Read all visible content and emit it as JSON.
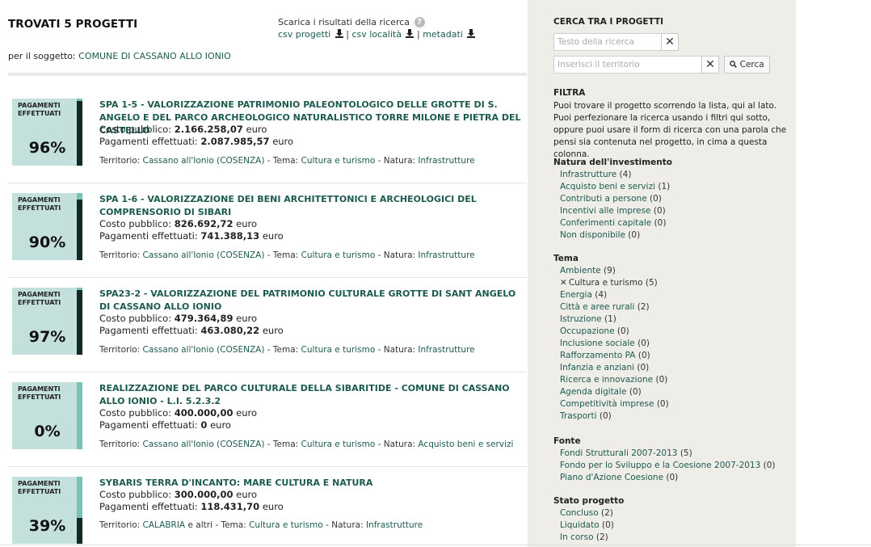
{
  "header": {
    "title": "TROVATI 5 PROGETTI",
    "subject_prefix": "per il soggetto:",
    "subject_value": "COMUNE DI CASSANO ALLO IONIO",
    "download_label": "Scarica i risultati della ricerca",
    "help_glyph": "?",
    "csv_progetti": "csv progetti",
    "csv_localita": "csv località",
    "metadati": "metadati",
    "sep": "|"
  },
  "projects": [
    {
      "badge_label_1": "PAGAMENTI",
      "badge_label_2": "EFFETTUATI",
      "percent": "96%",
      "progress": 0.96,
      "title": "SPA 1-5 - VALORIZZAZIONE PATRIMONIO PALEONTOLOGICO DELLE GROTTE DI S. ANGELO E DEL PARCO ARCHEOLOGICO NATURALISTICO TORRE MILONE E PIETRA DEL CASTELLO",
      "cost_label": "Costo pubblico:",
      "cost_value": "2.166.258,07",
      "paid_label": "Pagamenti effettuati:",
      "paid_value": "2.087.985,57",
      "unit": "euro",
      "territorio_label": "Territorio:",
      "territorio": "Cassano all'Ionio (COSENZA)",
      "tema_label": "- Tema:",
      "tema": "Cultura e turismo",
      "natura_label": "- Natura:",
      "natura": "Infrastrutture"
    },
    {
      "badge_label_1": "PAGAMENTI",
      "badge_label_2": "EFFETTUATI",
      "percent": "90%",
      "progress": 0.9,
      "title": "SPA 1-6 - VALORIZZAZIONE DEI BENI ARCHITETTONICI E ARCHEOLOGICI DEL COMPRENSORIO DI SIBARI",
      "cost_label": "Costo pubblico:",
      "cost_value": "826.692,72",
      "paid_label": "Pagamenti effettuati:",
      "paid_value": "741.388,13",
      "unit": "euro",
      "territorio_label": "Territorio:",
      "territorio": "Cassano all'Ionio (COSENZA)",
      "tema_label": "- Tema:",
      "tema": "Cultura e turismo",
      "natura_label": "- Natura:",
      "natura": "Infrastrutture"
    },
    {
      "badge_label_1": "PAGAMENTI",
      "badge_label_2": "EFFETTUATI",
      "percent": "97%",
      "progress": 0.97,
      "title": "SPA23-2 - VALORIZZAZIONE DEL PATRIMONIO CULTURALE GROTTE DI SANT ANGELO DI CASSANO ALLO IONIO",
      "cost_label": "Costo pubblico:",
      "cost_value": "479.364,89",
      "paid_label": "Pagamenti effettuati:",
      "paid_value": "463.080,22",
      "unit": "euro",
      "territorio_label": "Territorio:",
      "territorio": "Cassano all'Ionio (COSENZA)",
      "tema_label": "- Tema:",
      "tema": "Cultura e turismo",
      "natura_label": "- Natura:",
      "natura": "Infrastrutture"
    },
    {
      "badge_label_1": "PAGAMENTI",
      "badge_label_2": "EFFETTUATI",
      "percent": "0%",
      "progress": 0,
      "title": "REALIZZAZIONE DEL PARCO CULTURALE DELLA SIBARITIDE - COMUNE DI CASSANO ALLO IONIO - L.I. 5.2.3.2",
      "cost_label": "Costo pubblico:",
      "cost_value": "400.000,00",
      "paid_label": "Pagamenti effettuati:",
      "paid_value": "0",
      "unit": "euro",
      "territorio_label": "Territorio:",
      "territorio": "Cassano all'Ionio (COSENZA)",
      "tema_label": "- Tema:",
      "tema": "Cultura e turismo",
      "natura_label": "- Natura:",
      "natura": "Acquisto beni e servizi"
    },
    {
      "badge_label_1": "PAGAMENTI",
      "badge_label_2": "EFFETTUATI",
      "percent": "39%",
      "progress": 0.39,
      "title": "SYBARIS TERRA D'INCANTO: MARE CULTURA E NATURA",
      "cost_label": "Costo pubblico:",
      "cost_value": "300.000,00",
      "paid_label": "Pagamenti effettuati:",
      "paid_value": "118.431,70",
      "unit": "euro",
      "territorio_label": "Territorio:",
      "territorio": "CALABRIA",
      "territorio_extra": "e altri",
      "tema_label": "- Tema:",
      "tema": "Cultura e turismo",
      "natura_label": "- Natura:",
      "natura": "Infrastrutture"
    }
  ],
  "sidebar": {
    "search_title": "CERCA TRA I PROGETTI",
    "text_placeholder": "Testo della ricerca",
    "territory_placeholder": "Inserisci il territorio",
    "clear_glyph": "✕",
    "search_button": "Cerca",
    "filter_title": "FILTRA",
    "intro": "Puoi trovare il progetto scorrendo la lista, qui al lato. Puoi perfezionare la ricerca usando i filtri qui sotto, oppure puoi usare il form di ricerca con una parola che pensi sia contenuta nel progetto, in cima a questa colonna.",
    "groups": [
      {
        "title": "Natura dell'investimento",
        "items": [
          {
            "label": "Infrastrutture",
            "count": "(4)"
          },
          {
            "label": "Acquisto beni e servizi",
            "count": "(1)"
          },
          {
            "label": "Contributi a persone",
            "count": "(0)"
          },
          {
            "label": "Incentivi alle imprese",
            "count": "(0)"
          },
          {
            "label": "Conferimenti capitale",
            "count": "(0)"
          },
          {
            "label": "Non disponibile",
            "count": "(0)"
          }
        ]
      },
      {
        "title": "Tema",
        "items": [
          {
            "label": "Ambiente",
            "count": "(9)"
          },
          {
            "label": "Cultura e turismo",
            "count": "(5)",
            "selected": true
          },
          {
            "label": "Energia",
            "count": "(4)"
          },
          {
            "label": "Città e aree rurali",
            "count": "(2)"
          },
          {
            "label": "Istruzione",
            "count": "(1)"
          },
          {
            "label": "Occupazione",
            "count": "(0)"
          },
          {
            "label": "Inclusione sociale",
            "count": "(0)"
          },
          {
            "label": "Rafforzamento PA",
            "count": "(0)"
          },
          {
            "label": "Infanzia e anziani",
            "count": "(0)"
          },
          {
            "label": "Ricerca e innovazione",
            "count": "(0)"
          },
          {
            "label": "Agenda digitale",
            "count": "(0)"
          },
          {
            "label": "Competitività imprese",
            "count": "(0)"
          },
          {
            "label": "Trasporti",
            "count": "(0)"
          }
        ]
      },
      {
        "title": "Fonte",
        "items": [
          {
            "label": "Fondi Strutturali 2007-2013",
            "count": "(5)"
          },
          {
            "label": "Fondo per lo Sviluppo e la Coesione 2007-2013",
            "count": "(0)"
          },
          {
            "label": "Piano d'Azione Coesione",
            "count": "(0)"
          }
        ]
      },
      {
        "title": "Stato progetto",
        "items": [
          {
            "label": "Concluso",
            "count": "(2)"
          },
          {
            "label": "Liquidato",
            "count": "(0)"
          },
          {
            "label": "In corso",
            "count": "(2)"
          }
        ]
      }
    ]
  },
  "colors": {
    "link": "#1d5a50",
    "badge_bg": "#c3e0dc",
    "progress_track": "#77c3b8",
    "progress_fill": "#0e2a26",
    "sidebar_bg": "#eeede8"
  }
}
